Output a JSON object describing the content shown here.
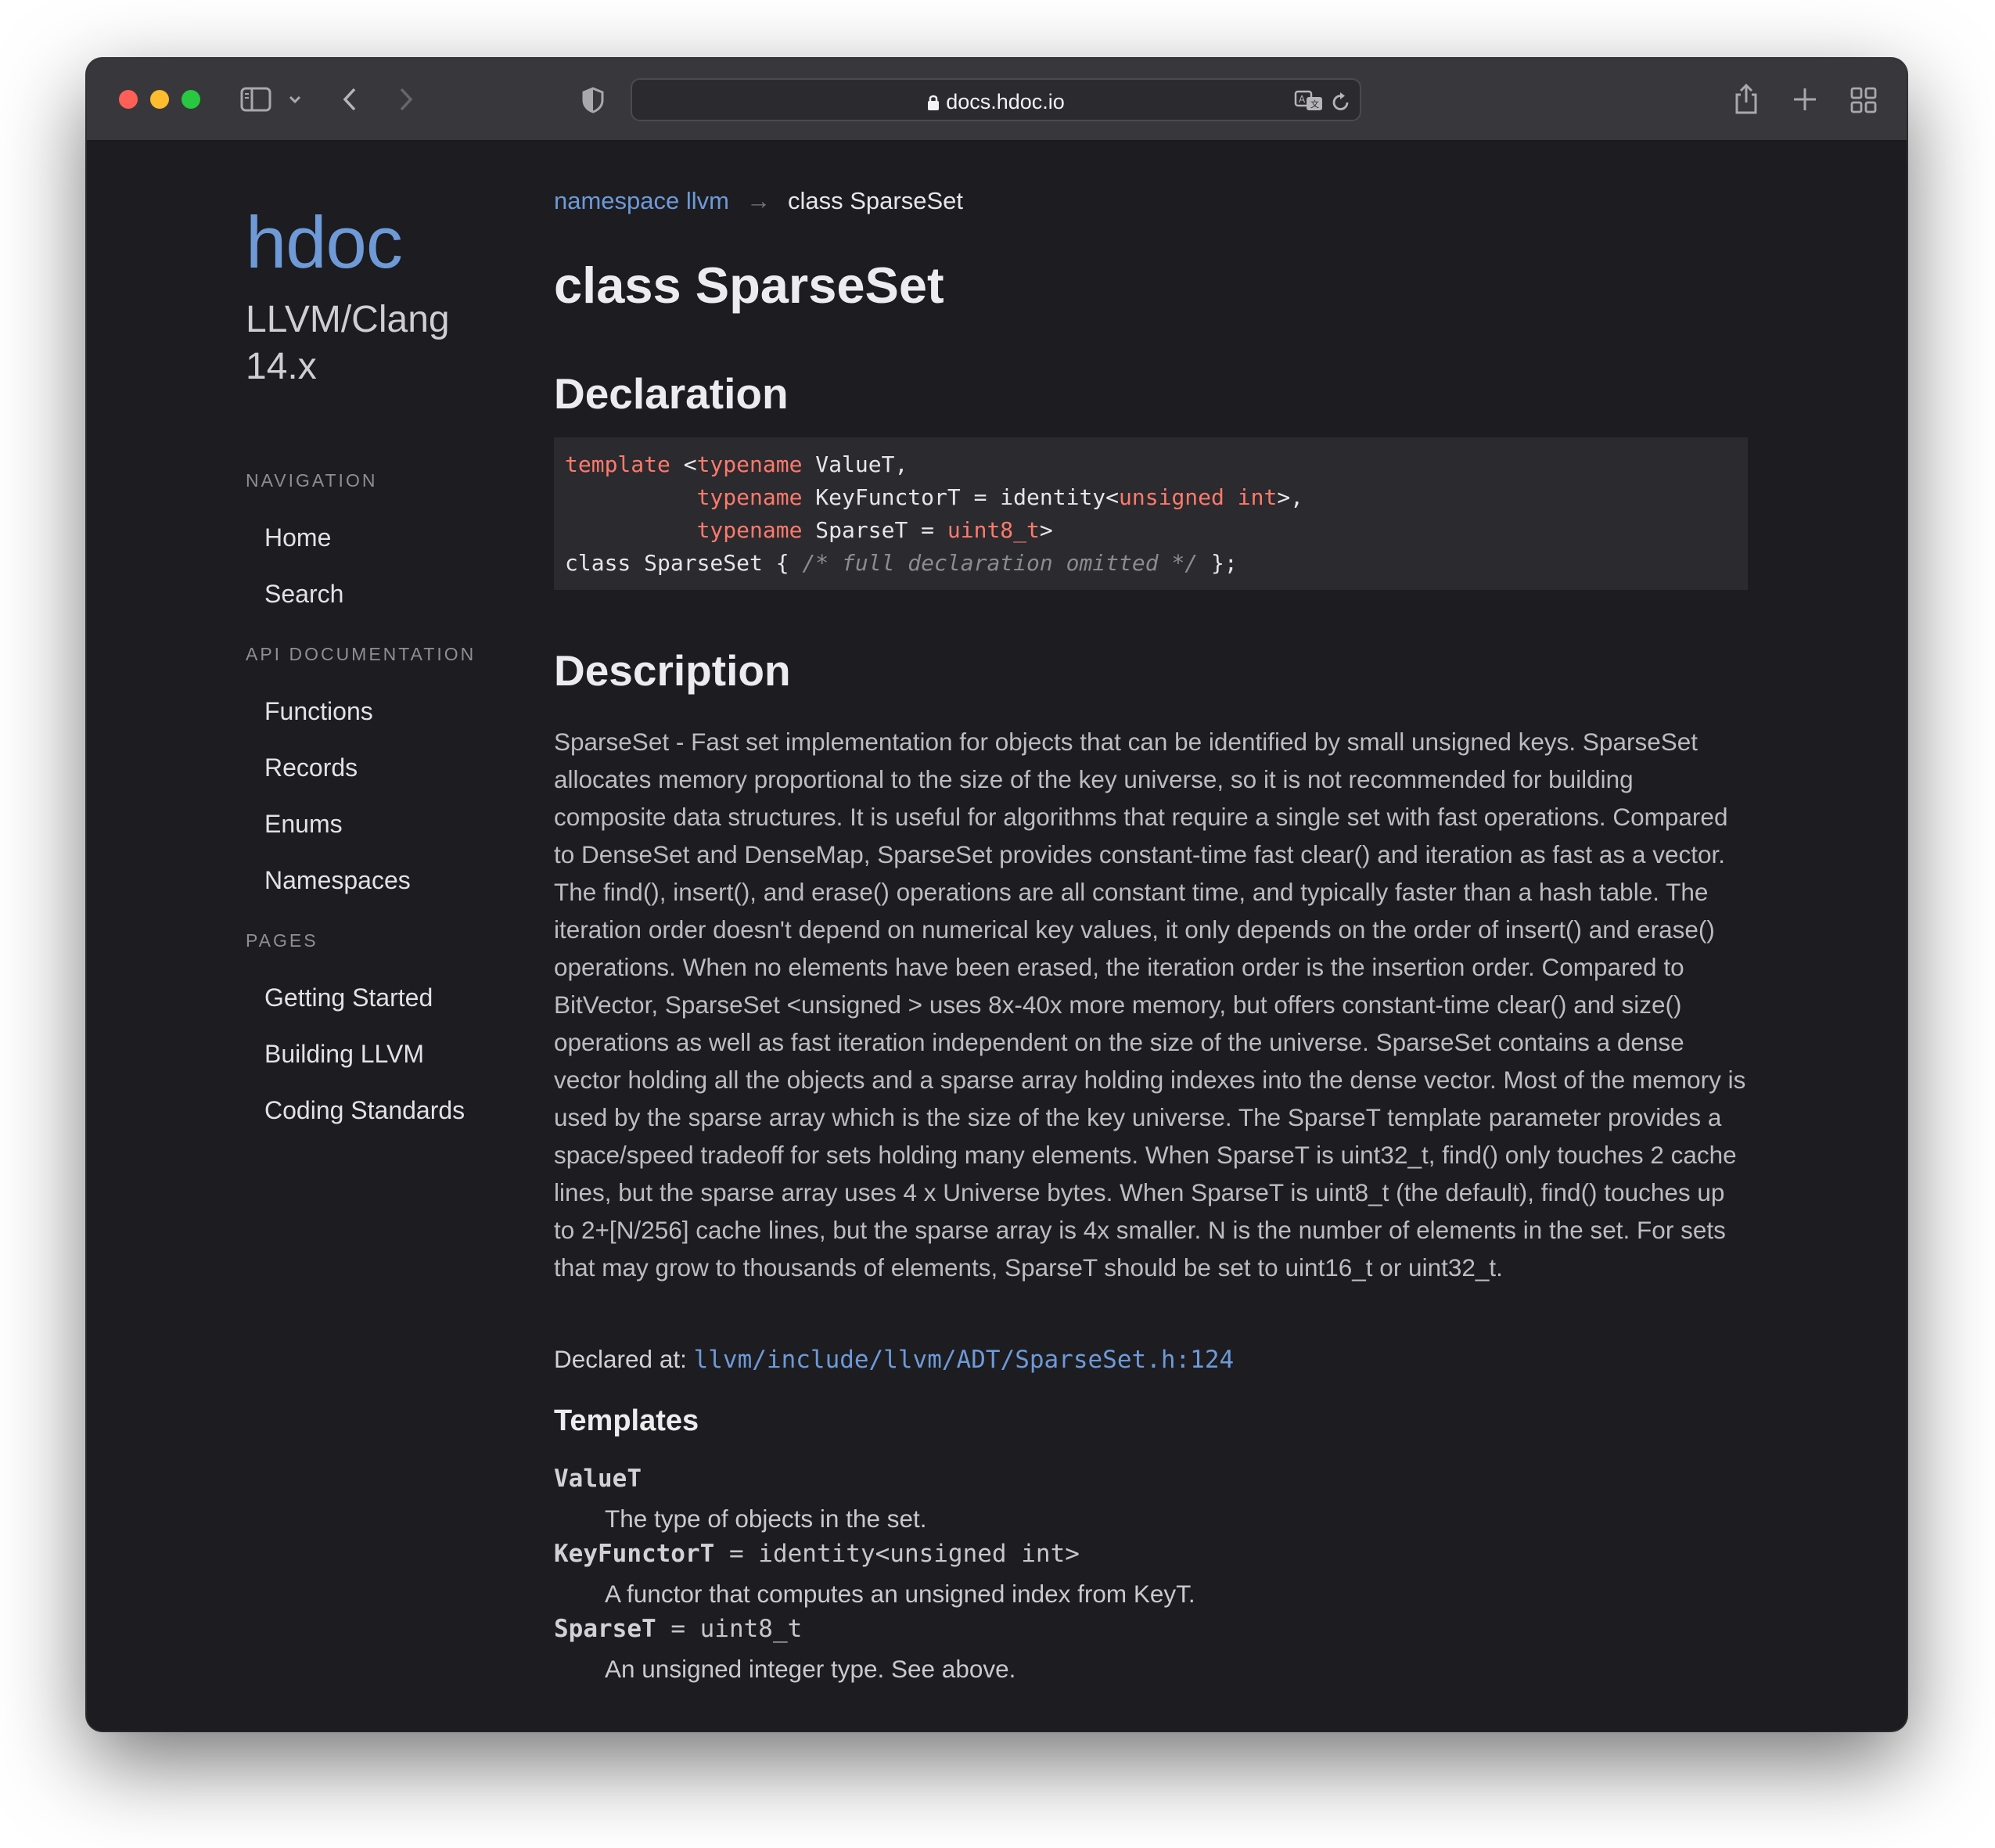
{
  "browser": {
    "url": "docs.hdoc.io"
  },
  "sidebar": {
    "brand": "hdoc",
    "project_line1": "LLVM/Clang",
    "project_line2": "14.x",
    "navigation_heading": "NAVIGATION",
    "navigation_items": [
      "Home",
      "Search"
    ],
    "api_heading": "API DOCUMENTATION",
    "api_items": [
      "Functions",
      "Records",
      "Enums",
      "Namespaces"
    ],
    "pages_heading": "PAGES",
    "pages_items": [
      "Getting Started",
      "Building LLVM",
      "Coding Standards"
    ]
  },
  "breadcrumb": {
    "parent": "namespace llvm",
    "separator": "→",
    "current": "class SparseSet"
  },
  "page_title": "class SparseSet",
  "declaration": {
    "heading": "Declaration",
    "code": {
      "kw_template": "template",
      "open": " <",
      "kw_typename": "typename",
      "p1": " ValueT,",
      "indent": "          ",
      "p2a": " KeyFunctorT = identity<",
      "kw_unsigned_int": "unsigned int",
      "p2b": ">,",
      "p3a": " SparseT = ",
      "kw_uint8": "uint8_t",
      "p3b": ">",
      "class_line": "class SparseSet { ",
      "comment": "/* full declaration omitted */",
      "close": " };"
    }
  },
  "description": {
    "heading": "Description",
    "text": "SparseSet - Fast set implementation for objects that can be identified by small unsigned keys. SparseSet allocates memory proportional to the size of the key universe, so it is not recommended for building composite data structures. It is useful for algorithms that require a single set with fast operations. Compared to DenseSet and DenseMap, SparseSet provides constant-time fast clear() and iteration as fast as a vector. The find(), insert(), and erase() operations are all constant time, and typically faster than a hash table. The iteration order doesn't depend on numerical key values, it only depends on the order of insert() and erase() operations. When no elements have been erased, the iteration order is the insertion order. Compared to BitVector, SparseSet <unsigned > uses 8x-40x more memory, but offers constant-time clear() and size() operations as well as fast iteration independent on the size of the universe. SparseSet contains a dense vector holding all the objects and a sparse array holding indexes into the dense vector. Most of the memory is used by the sparse array which is the size of the key universe. The SparseT template parameter provides a space/speed tradeoff for sets holding many elements. When SparseT is uint32_t, find() only touches 2 cache lines, but the sparse array uses 4 x Universe bytes. When SparseT is uint8_t (the default), find() touches up to 2+[N/256] cache lines, but the sparse array is 4x smaller. N is the number of elements in the set. For sets that may grow to thousands of elements, SparseT should be set to uint16_t or uint32_t.",
    "declared_label": "Declared at: ",
    "declared_link": "llvm/include/llvm/ADT/SparseSet.h:124"
  },
  "templates": {
    "heading": "Templates",
    "items": [
      {
        "name": "ValueT",
        "default": "",
        "desc": "The type of objects in the set."
      },
      {
        "name": "KeyFunctorT",
        "default": " = identity<unsigned int>",
        "desc": "A functor that computes an unsigned index from KeyT."
      },
      {
        "name": "SparseT",
        "default": " = uint8_t",
        "desc": "An unsigned integer type. See above."
      }
    ]
  }
}
